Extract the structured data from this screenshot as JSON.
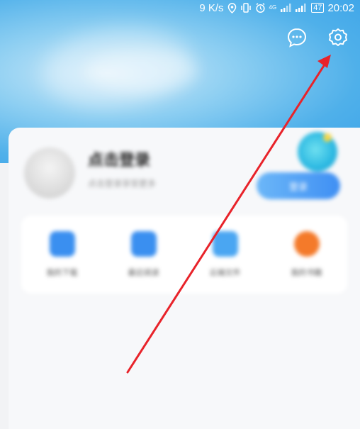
{
  "status_bar": {
    "speed": "9 K/s",
    "network": "4G",
    "battery": "47",
    "time": "20:02"
  },
  "profile": {
    "title": "点击登录",
    "subtitle": "点击登录享受更多",
    "vip_button": "登录"
  },
  "quick_actions": [
    {
      "label": "我的下载",
      "color": "#3a8ff0"
    },
    {
      "label": "最近阅读",
      "color": "#3a8ff0"
    },
    {
      "label": "云端文件",
      "color": "#4aa6f2"
    },
    {
      "label": "我的书籍",
      "color": "#f47a2a"
    }
  ],
  "colors": {
    "hero": "#4fb0ea",
    "arrow": "#e8232a"
  },
  "icons": {
    "message": "chat-bubble-icon",
    "settings": "gear-icon"
  }
}
